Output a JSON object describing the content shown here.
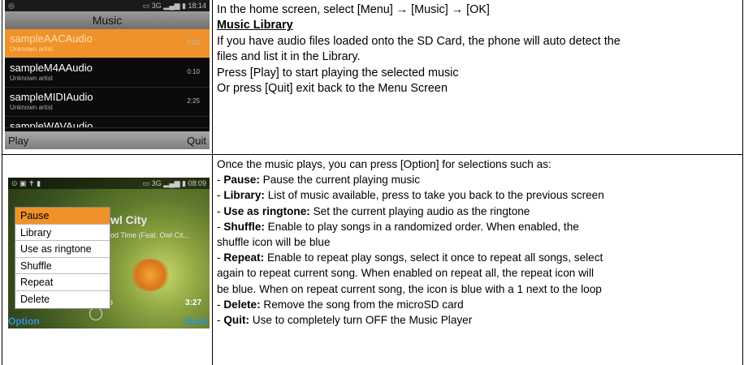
{
  "phone1": {
    "status_left": "◎",
    "status_right": "▭ 3G ▂▄▆ ▮ 18:14",
    "title": "Music",
    "items": [
      {
        "name": "sampleAACAudio",
        "artist": "Unknown artist",
        "duration": "0:03"
      },
      {
        "name": "sampleM4AAudio",
        "artist": "Unknown artist",
        "duration": "0:10"
      },
      {
        "name": "sampleMIDIAudio",
        "artist": "Unknown artist",
        "duration": "2:25"
      },
      {
        "name": "sampleWAVAudio",
        "artist": "",
        "duration": ""
      }
    ],
    "softkey_left": "Play",
    "softkey_right": "Quit"
  },
  "row1": {
    "line1": "In the home screen, select [Menu] → [Music] → [OK]",
    "heading": "Music Library",
    "line3": "If you have audio files loaded onto the SD Card, the phone will auto detect the",
    "line4": "files and list it in the Library.",
    "line5": "Press [Play] to start playing the selected music",
    "line6": "Or press [Quit] exit back to the Menu Screen"
  },
  "phone2": {
    "status_left": "⊙ ▣ ✝ ▮",
    "status_right": "▭ 3G ▂▄▆ ▮ 08:09",
    "bg_title": "wl City",
    "bg_sub": "od Time (Feat. Owl Cit...",
    "time": "3:27",
    "menu": [
      "Pause",
      "Library",
      "Use as ringtone",
      "Shuffle",
      "Repeat",
      "Delete"
    ],
    "softkey_left": "Option",
    "softkey_right": "Back"
  },
  "row2": {
    "intro": "Once the music plays, you can press [Option] for selections such as:",
    "options": [
      {
        "label": "Pause:",
        "desc": " Pause the current playing music"
      },
      {
        "label": "Library:",
        "desc": " List of music available, press to take you back to the previous screen"
      },
      {
        "label": "Use as ringtone:",
        "desc": " Set the current playing audio as the ringtone"
      },
      {
        "label": "Shuffle:",
        "desc": " Enable to play songs in a randomized order. When enabled, the"
      },
      {
        "label": "",
        "desc": "shuffle icon will be blue"
      },
      {
        "label": "Repeat:",
        "desc": " Enable to repeat play songs, select it once to repeat all songs, select"
      },
      {
        "label": "",
        "desc": "again to repeat current song. When enabled on repeat all, the repeat icon will"
      },
      {
        "label": "",
        "desc": "be blue. When on repeat current song, the icon is blue with a 1 next to the loop"
      },
      {
        "label": "Delete:",
        "desc": " Remove the song from the microSD card"
      },
      {
        "label": "Quit:",
        "desc": " Use to completely turn OFF the Music Player"
      }
    ]
  },
  "colors": {
    "highlight": "#f0922a",
    "softkey_blue": "#2f8fd8"
  }
}
